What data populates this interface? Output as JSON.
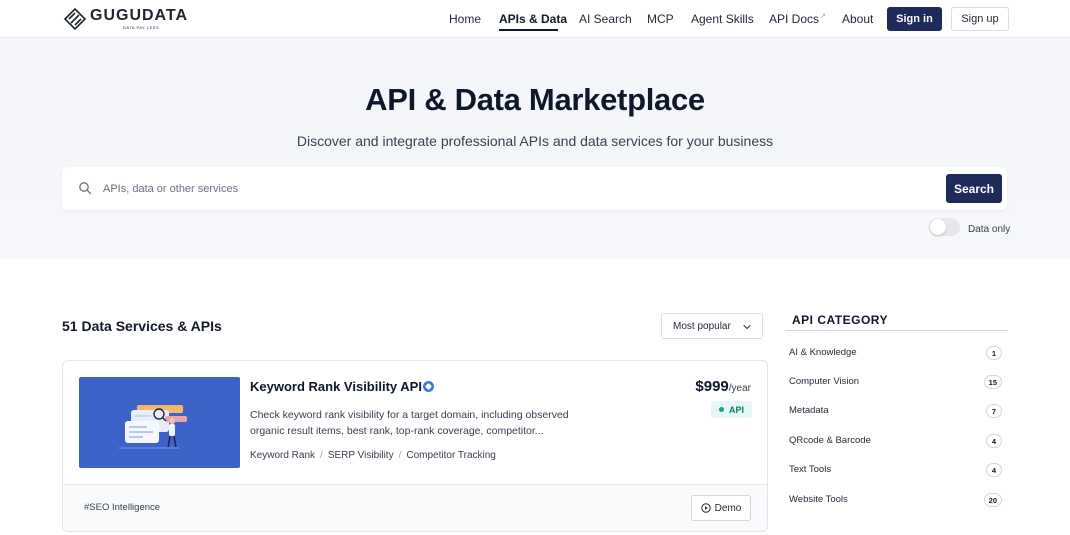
{
  "brand": {
    "name": "GUGUDATA",
    "tagline": "DATA PAY LESS"
  },
  "nav": {
    "links": [
      {
        "label": "Home",
        "active": false
      },
      {
        "label": "APIs & Data",
        "active": true
      },
      {
        "label": "AI Search",
        "active": false
      },
      {
        "label": "MCP",
        "active": false
      },
      {
        "label": "Agent Skills",
        "active": false
      },
      {
        "label": "API Docs",
        "active": false,
        "external": true
      },
      {
        "label": "About",
        "active": false
      }
    ],
    "sign_in": "Sign in",
    "sign_up": "Sign up"
  },
  "hero": {
    "title": "API & Data Marketplace",
    "subtitle": "Discover and integrate professional APIs and data services for your business",
    "search_placeholder": "APIs, data or other services",
    "search_value": "",
    "search_button": "Search",
    "toggle_label": "Data only",
    "toggle_on": false
  },
  "results": {
    "count_label": "51 Data Services & APIs",
    "sort_selected": "Most popular",
    "items": [
      {
        "title": "Keyword Rank Visibility API",
        "verified": true,
        "price": "$999",
        "price_unit": "/year",
        "type_badge": "API",
        "description": "Check keyword rank visibility for a target domain, including observed organic result items, best rank, top-rank coverage, competitor...",
        "tags": [
          "Keyword Rank",
          "SERP Visibility",
          "Competitor Tracking"
        ],
        "hashtag": "#SEO Intelligence",
        "demo_label": "Demo"
      }
    ]
  },
  "sidebar": {
    "title": "API CATEGORY",
    "categories": [
      {
        "label": "AI & Knowledge",
        "count": "1"
      },
      {
        "label": "Computer Vision",
        "count": "15"
      },
      {
        "label": "Metadata",
        "count": "7"
      },
      {
        "label": "QRcode & Barcode",
        "count": "4"
      },
      {
        "label": "Text Tools",
        "count": "4"
      },
      {
        "label": "Website Tools",
        "count": "20"
      }
    ]
  },
  "colors": {
    "primary": "#1e2a5a",
    "hero_bg": "#f4f6f9",
    "thumb_bg": "#3d63c9",
    "badge_green": "#0f766e"
  }
}
